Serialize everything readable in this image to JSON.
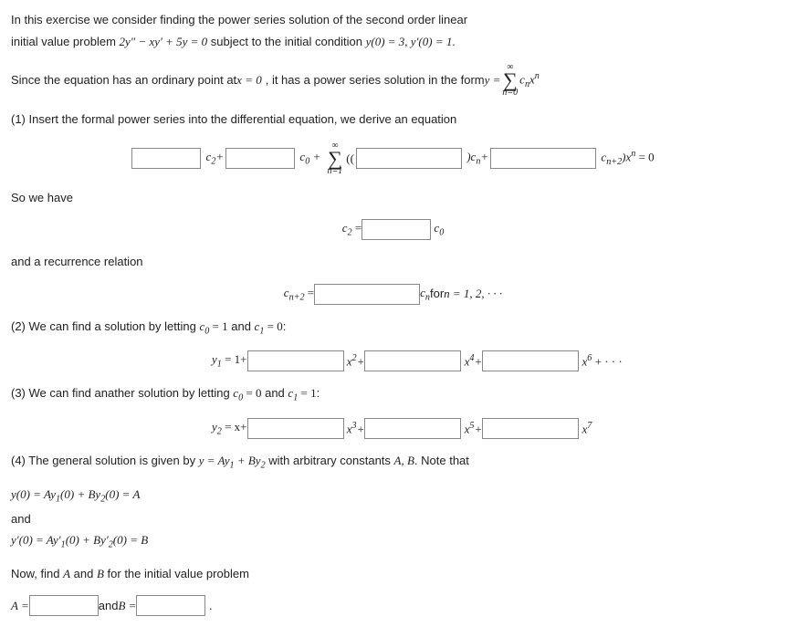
{
  "intro1": "In this exercise we consider finding the power series solution of the second order linear",
  "intro2_a": "initial value problem ",
  "intro2_b": " subject to the initial condition ",
  "eq_ode": "2y″ − xy′ + 5y = 0",
  "eq_ic": "y(0) = 3, y′(0) = 1",
  "since_a": "Since the equation has an ordinary point at ",
  "since_x0": "x = 0",
  "since_b": ", it has a power series solution in the form ",
  "since_rhs_pre": "y = ",
  "q1": "(1) Insert the formal power series into the differential equation, we derive an equation",
  "c2p": "c",
  "plus": "+",
  "c0p": "c",
  "sum_open": "((",
  "sum_close": ")c",
  "tail1": ")x",
  "tail2": " = 0",
  "so_we_have": "So we have",
  "c2eq_a": "c",
  "c2eq_b": " = ",
  "c2eq_c": "c",
  "recur": "and a recurrence relation",
  "rec_a": "c",
  "rec_b": " = ",
  "rec_c": " c",
  "rec_d": " for ",
  "rec_e": "n = 1, 2, · · ·",
  "q2_a": "(2) We can find a solution by letting ",
  "q2_b": "c",
  "q2_c": " and ",
  "q2_d": ":",
  "y1_a": "y",
  "y1_b": " = 1+",
  "x2_a": "x",
  "x4_a": "x",
  "x6_a": "x",
  "dots": " + · · ·",
  "q3_a": "(3) We can find anather solution by letting ",
  "q3_b": " and ",
  "q3_c": ":",
  "y2_a": "y",
  "y2_b": " = x+",
  "x3_a": "x",
  "x5_a": "x",
  "x7_a": "x",
  "q4_a": "(4) The general solution is given by ",
  "q4_b": "y = Ay",
  "q4_c": " + By",
  "q4_d": " with arbitrary constants ",
  "q4_e": "A, B",
  "q4_f": ". Note that",
  "l_y0": "y(0) = Ay",
  "l_y0b": "(0) + By",
  "l_y0c": "(0) = A",
  "and": "and",
  "l_yp0": "y′(0) = Ay′",
  "l_yp0b": "(0) + By′",
  "l_yp0c": "(0) = B",
  "now": "Now, find ",
  "now_b": " and ",
  "now_c": " for the initial value problem",
  "A": "A",
  "B": "B",
  "Aeq": "A = ",
  "and2": " and ",
  "Beq": "B = ",
  "period": ".",
  "sub0": "0",
  "sub1": "1",
  "sub2": "2",
  "subn": "n",
  "subn2": "n+2",
  "sup2": "2",
  "sup3": "3",
  "sup4": "4",
  "sup5": "5",
  "sup6": "6",
  "sup7": "7",
  "supn": "n",
  "n1": "n=1",
  "n0": "n=0",
  "inf": "∞",
  "one": " = 1",
  "zero": " = 0",
  "cnxn": "c",
  "xvar": "x"
}
